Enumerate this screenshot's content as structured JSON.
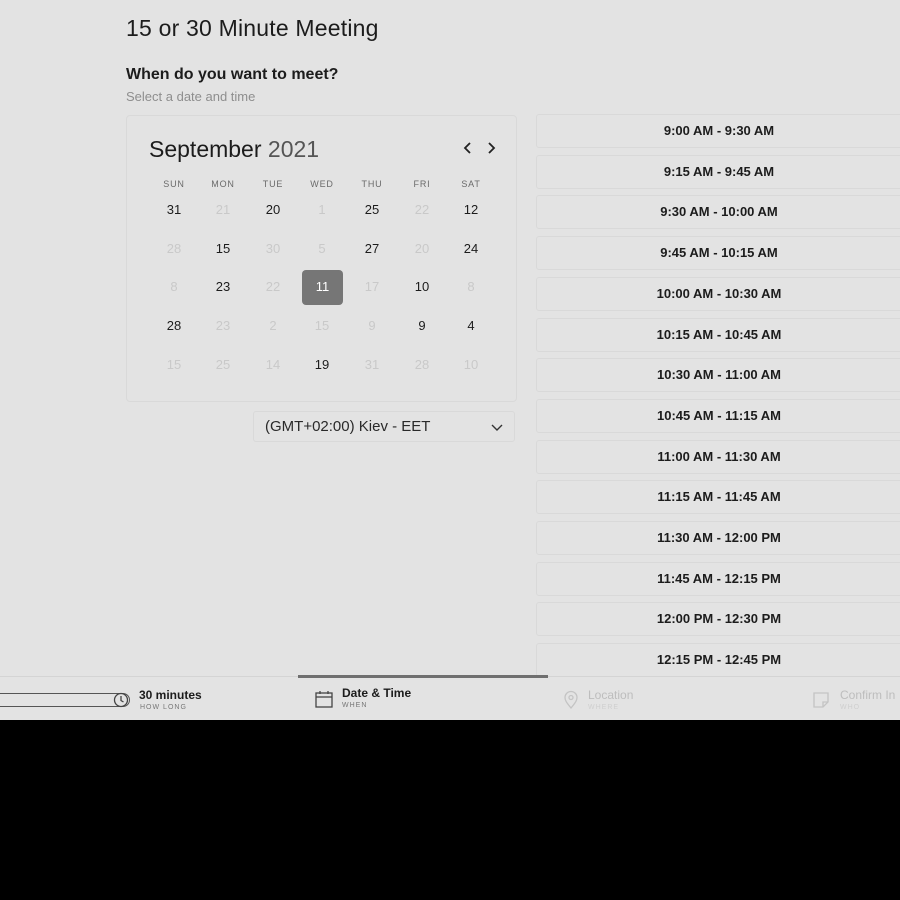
{
  "page": {
    "title": "15 or 30 Minute Meeting",
    "section_title": "When do you want to meet?",
    "section_subtitle": "Select a date and time"
  },
  "calendar": {
    "month": "September",
    "year": "2021",
    "prev_icon": "chevron-left-icon",
    "next_icon": "chevron-right-icon",
    "weekdays": [
      "SUN",
      "MON",
      "TUE",
      "WED",
      "THU",
      "FRI",
      "SAT"
    ],
    "weeks": [
      [
        {
          "d": "31",
          "s": "active"
        },
        {
          "d": "21",
          "s": "muted"
        },
        {
          "d": "20",
          "s": "active"
        },
        {
          "d": "1",
          "s": "muted"
        },
        {
          "d": "25",
          "s": "active"
        },
        {
          "d": "22",
          "s": "muted"
        },
        {
          "d": "12",
          "s": "active"
        }
      ],
      [
        {
          "d": "28",
          "s": "muted"
        },
        {
          "d": "15",
          "s": "active"
        },
        {
          "d": "30",
          "s": "muted"
        },
        {
          "d": "5",
          "s": "muted"
        },
        {
          "d": "27",
          "s": "active"
        },
        {
          "d": "20",
          "s": "muted"
        },
        {
          "d": "24",
          "s": "active"
        }
      ],
      [
        {
          "d": "8",
          "s": "muted"
        },
        {
          "d": "23",
          "s": "active"
        },
        {
          "d": "22",
          "s": "muted"
        },
        {
          "d": "11",
          "s": "selected"
        },
        {
          "d": "17",
          "s": "muted"
        },
        {
          "d": "10",
          "s": "active"
        },
        {
          "d": "8",
          "s": "muted"
        }
      ],
      [
        {
          "d": "28",
          "s": "active"
        },
        {
          "d": "23",
          "s": "muted"
        },
        {
          "d": "2",
          "s": "muted"
        },
        {
          "d": "15",
          "s": "muted"
        },
        {
          "d": "9",
          "s": "muted"
        },
        {
          "d": "9",
          "s": "active"
        },
        {
          "d": "4",
          "s": "active"
        }
      ],
      [
        {
          "d": "15",
          "s": "muted"
        },
        {
          "d": "25",
          "s": "muted"
        },
        {
          "d": "14",
          "s": "muted"
        },
        {
          "d": "19",
          "s": "active"
        },
        {
          "d": "31",
          "s": "muted"
        },
        {
          "d": "28",
          "s": "muted"
        },
        {
          "d": "10",
          "s": "muted"
        }
      ]
    ]
  },
  "timezone": {
    "value": "(GMT+02:00) Kiev - EET",
    "icon": "chevron-down-icon"
  },
  "time_slots": [
    "9:00 AM - 9:30 AM",
    "9:15 AM - 9:45 AM",
    "9:30 AM - 10:00 AM",
    "9:45 AM - 10:15 AM",
    "10:00 AM - 10:30 AM",
    "10:15 AM - 10:45 AM",
    "10:30 AM - 11:00 AM",
    "10:45 AM - 11:15 AM",
    "11:00 AM - 11:30 AM",
    "11:15 AM - 11:45 AM",
    "11:30 AM - 12:00 PM",
    "11:45 AM - 12:15 PM",
    "12:00 PM - 12:30 PM",
    "12:15 PM - 12:45 PM"
  ],
  "steps": {
    "duration": {
      "label": "30 minutes",
      "sub": "HOW LONG",
      "icon": "clock-icon"
    },
    "datetime": {
      "label": "Date & Time",
      "sub": "WHEN",
      "icon": "calendar-icon"
    },
    "location": {
      "label": "Location",
      "sub": "WHERE",
      "icon": "location-pin-icon"
    },
    "confirm": {
      "label": "Confirm In",
      "sub": "WHO",
      "icon": "note-icon"
    }
  },
  "colors": {
    "background": "#e3e3e3",
    "selected_day": "#767676",
    "active_step_bar": "#6f6f6f"
  }
}
